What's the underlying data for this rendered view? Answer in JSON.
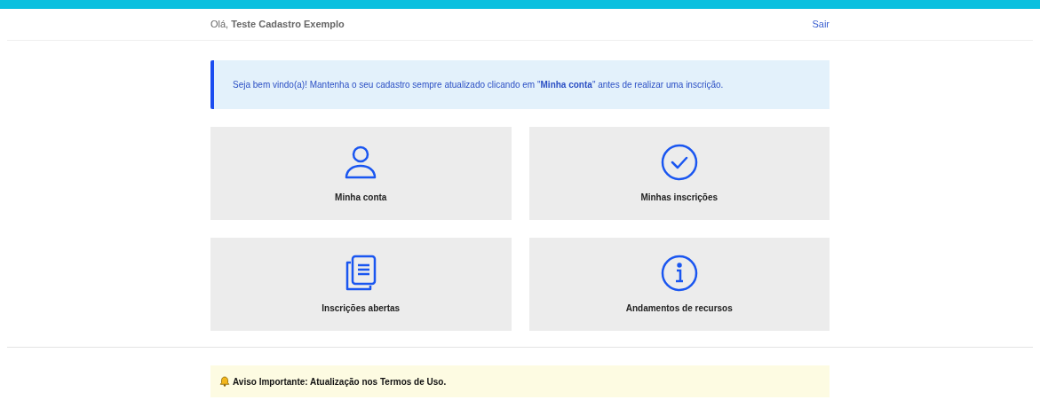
{
  "header": {
    "greeting": "Olá, **Teste Cadastro Exemplo**",
    "logout": "Sair"
  },
  "alert": {
    "text": "Seja bem vindo(a)! Mantenha o seu cadastro sempre atualizado clicando em \"**Minha conta**\" antes de realizar uma inscrição."
  },
  "cards": [
    {
      "kind": "person",
      "label": "Minha conta"
    },
    {
      "kind": "check",
      "label": "Minhas inscrições"
    },
    {
      "kind": "documents",
      "label": "Inscrições abertas"
    },
    {
      "kind": "info",
      "label": "Andamentos de recursos"
    }
  ],
  "notice": {
    "text": "Aviso Importante: Atualização nos Termos de Uso."
  }
}
